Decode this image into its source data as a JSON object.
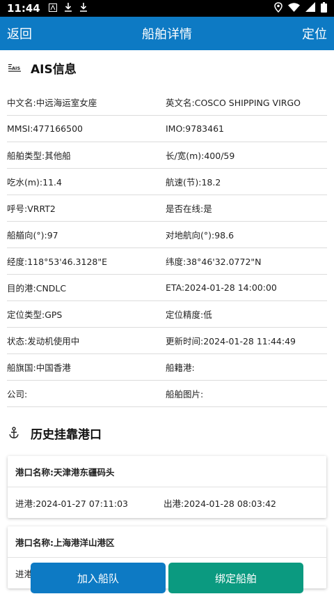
{
  "status_bar": {
    "time": "11:44"
  },
  "header": {
    "back": "返回",
    "title": "船舶详情",
    "locate": "定位"
  },
  "ais": {
    "title": "AIS信息",
    "icon_text": "AIS",
    "rows": [
      [
        "中文名:中远海运室女座",
        "英文名:COSCO SHIPPING VIRGO"
      ],
      [
        "MMSI:477166500",
        "IMO:9783461"
      ],
      [
        "船舶类型:其他船",
        "长/宽(m):400/59"
      ],
      [
        "吃水(m):11.4",
        "航速(节):18.2"
      ],
      [
        "呼号:VRRT2",
        "是否在线:是"
      ],
      [
        "船艏向(°):97",
        "对地航向(°):98.6"
      ],
      [
        "经度:118°53'46.3128\"E",
        "纬度:38°46'32.0772\"N"
      ],
      [
        "目的港:CNDLC",
        "ETA:2024-01-28 14:00:00"
      ],
      [
        "定位类型:GPS",
        "定位精度:低"
      ],
      [
        "状态:发动机使用中",
        "更新时间:2024-01-28 11:44:49"
      ],
      [
        "船旗国:中国香港",
        "船籍港:"
      ],
      [
        "公司:",
        "船舶图片:"
      ]
    ]
  },
  "history": {
    "title": "历史挂靠港口",
    "ports": [
      {
        "name": "港口名称:天津港东疆码头",
        "in": "进港:2024-01-27 07:11:03",
        "out": "出港:2024-01-28 08:03:42"
      },
      {
        "name": "港口名称:上海港洋山港区",
        "in": "进港",
        "out": ""
      }
    ]
  },
  "actions": {
    "join_fleet": "加入船队",
    "bind_ship": "绑定船舶"
  },
  "colors": {
    "primary": "#0d7ac4",
    "secondary": "#0b9a80"
  }
}
